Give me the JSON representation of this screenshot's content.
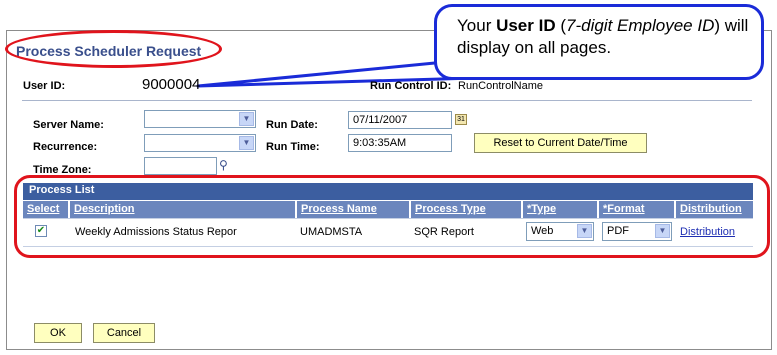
{
  "callout": {
    "pre": "Your ",
    "bold": "User ID",
    "mid": " (",
    "italic": "7-digit Employee ID",
    "post": ") will display on all pages."
  },
  "page_title": "Process Scheduler Request",
  "user_id_label": "User ID:",
  "user_id_value": "9000004",
  "run_control_label": "Run Control ID:",
  "run_control_value": "RunControlName",
  "server_name_label": "Server Name:",
  "server_name_value": "",
  "recurrence_label": "Recurrence:",
  "recurrence_value": "",
  "time_zone_label": "Time Zone:",
  "time_zone_value": "",
  "run_date_label": "Run Date:",
  "run_date_value": "07/11/2007",
  "run_time_label": "Run Time:",
  "run_time_value": "9:03:35AM",
  "reset_button": "Reset to Current Date/Time",
  "process_list": {
    "title": "Process List",
    "columns": [
      "Select",
      "Description",
      "Process Name",
      "Process Type",
      "*Type",
      "*Format",
      "Distribution"
    ],
    "rows": [
      {
        "selected": true,
        "description": "Weekly Admissions Status Repor",
        "process_name": "UMADMSTA",
        "process_type": "SQR Report",
        "type": "Web",
        "format": "PDF",
        "distribution": "Distribution"
      }
    ]
  },
  "ok_button": "OK",
  "cancel_button": "Cancel",
  "icons": {
    "dropdown": "chevron-down-icon",
    "calendar": "calendar-icon",
    "lookup": "magnifier-icon"
  }
}
